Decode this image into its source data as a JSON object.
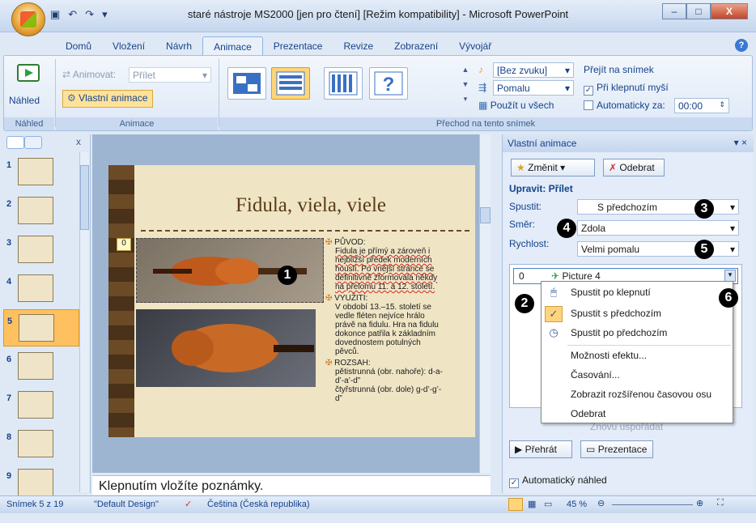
{
  "window": {
    "title": "staré nástroje MS2000 [jen pro čtení] [Režim kompatibility] - Microsoft PowerPoint",
    "min": "–",
    "max": "□",
    "close": "X"
  },
  "qat": {
    "save": "▣",
    "undo": "↶",
    "redo": "↷",
    "more": "▾"
  },
  "tabs": [
    "Domů",
    "Vložení",
    "Návrh",
    "Animace",
    "Prezentace",
    "Revize",
    "Zobrazení",
    "Vývojář"
  ],
  "help": "?",
  "ribbon": {
    "preview_label": "Náhled",
    "group_preview": "Náhled",
    "animate_label": "Animovat:",
    "animate_value": "Přílet",
    "custom_anim": "Vlastní animace",
    "group_anim": "Animace",
    "sound_value": "[Bez zvuku]",
    "speed_value": "Pomalu",
    "apply_all": "Použít u všech",
    "advance_title": "Přejít na snímek",
    "on_click": "Při klepnutí myší",
    "auto_after": "Automaticky za:",
    "auto_time": "00:00",
    "group_transition": "Přechod na tento snímek"
  },
  "slides": [
    "1",
    "2",
    "3",
    "4",
    "5",
    "6",
    "7",
    "8",
    "9"
  ],
  "slides_panel": {
    "close": "x"
  },
  "slide": {
    "title": "Fidula, viela, viele",
    "tag": "0",
    "callout1": "1",
    "b1_head": "PŮVOD:",
    "b1_text": "Fidula  je přímý a zároveň i nejbližší předek moderních houslí. Po vnější stránce se definitivně zformovala někdy na přelomu  11. a 12. století.",
    "b2_head": "VYUŽITÍ:",
    "b2_text": "V období 13.–15. století se vedle fléten nejvíce hrálo právě na fidulu. Hra na fidulu dokonce patřila k základním dovednostem potulných pěvců.",
    "b3_head": "ROZSAH:",
    "b3_text": "pětistrunná (obr. nahoře): d-a-d’-a’-d”",
    "b3_text2": "čtyřstrunná (obr. dole) g-d’-g’-d”"
  },
  "notes": "Klepnutím vložíte poznámky.",
  "taskpane": {
    "title": "Vlastní animace",
    "change_btn": "Změnit",
    "remove_btn": "Odebrat",
    "edit_heading": "Upravit: Přílet",
    "start_label": "Spustit:",
    "start_value": "S předchozím",
    "dir_label": "Směr:",
    "dir_value": "Zdola",
    "speed_label": "Rychlost:",
    "speed_value": "Velmi pomalu",
    "list_item_num": "0",
    "list_item_name": "Picture 4",
    "reorder_label": "Znovu uspořádat",
    "play_btn": "Přehrát",
    "show_btn": "Prezentace",
    "auto_preview": "Automatický náhled"
  },
  "menu": [
    {
      "label": "Spustit po klepnutí",
      "icon": "mouse-icon",
      "checked": false
    },
    {
      "label": "Spustit s předchozím",
      "icon": "check-icon",
      "checked": true
    },
    {
      "label": "Spustit po předchozím",
      "icon": "clock-icon",
      "checked": false
    },
    {
      "label": "Možnosti efektu...",
      "checked": false
    },
    {
      "label": "Časování...",
      "checked": false
    },
    {
      "label": "Zobrazit rozšířenou časovou osu",
      "checked": false
    },
    {
      "label": "Odebrat",
      "checked": false
    }
  ],
  "callouts": {
    "c2": "2",
    "c3": "3",
    "c4": "4",
    "c5": "5",
    "c6": "6"
  },
  "status": {
    "slide": "Snímek 5 z 19",
    "design": "\"Default Design\"",
    "language": "Čeština (Česká republika)",
    "zoom": "45 %"
  }
}
